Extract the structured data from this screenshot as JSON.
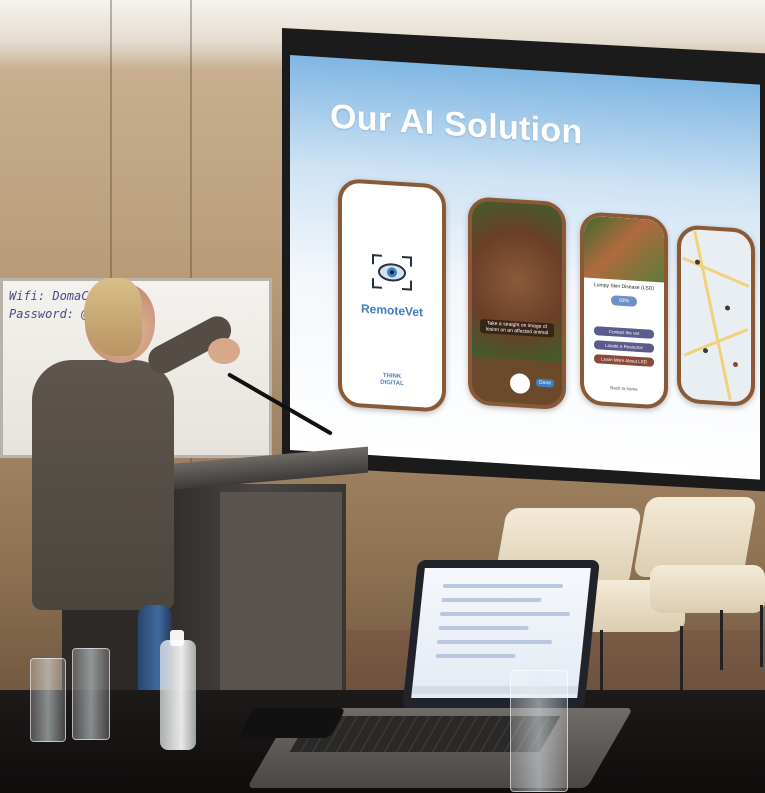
{
  "slide": {
    "title": "Our AI Solution",
    "app_name": "RemoteVet",
    "brand_line1": "THINK",
    "brand_line2": "DIGITAL",
    "camera_caption": "Take a straight on image of lesion on an affected animal",
    "camera_done": "Done",
    "result_title": "Lumpy Skin Disease (LSD)",
    "result_badge": "93%",
    "result_buttons": [
      "Contact the vet",
      "Locate a Resource",
      "Learn More About LSD"
    ],
    "result_close": "Back to home"
  },
  "whiteboard": {
    "line1": "Wifi: DomaConf",
    "line2": "Password: @D"
  },
  "colors": {
    "slide_top": "#7fb6e3",
    "phone_frame": "#8a5a36",
    "brand_blue": "#3e7fbe",
    "button_purple": "#5d5a8c"
  }
}
